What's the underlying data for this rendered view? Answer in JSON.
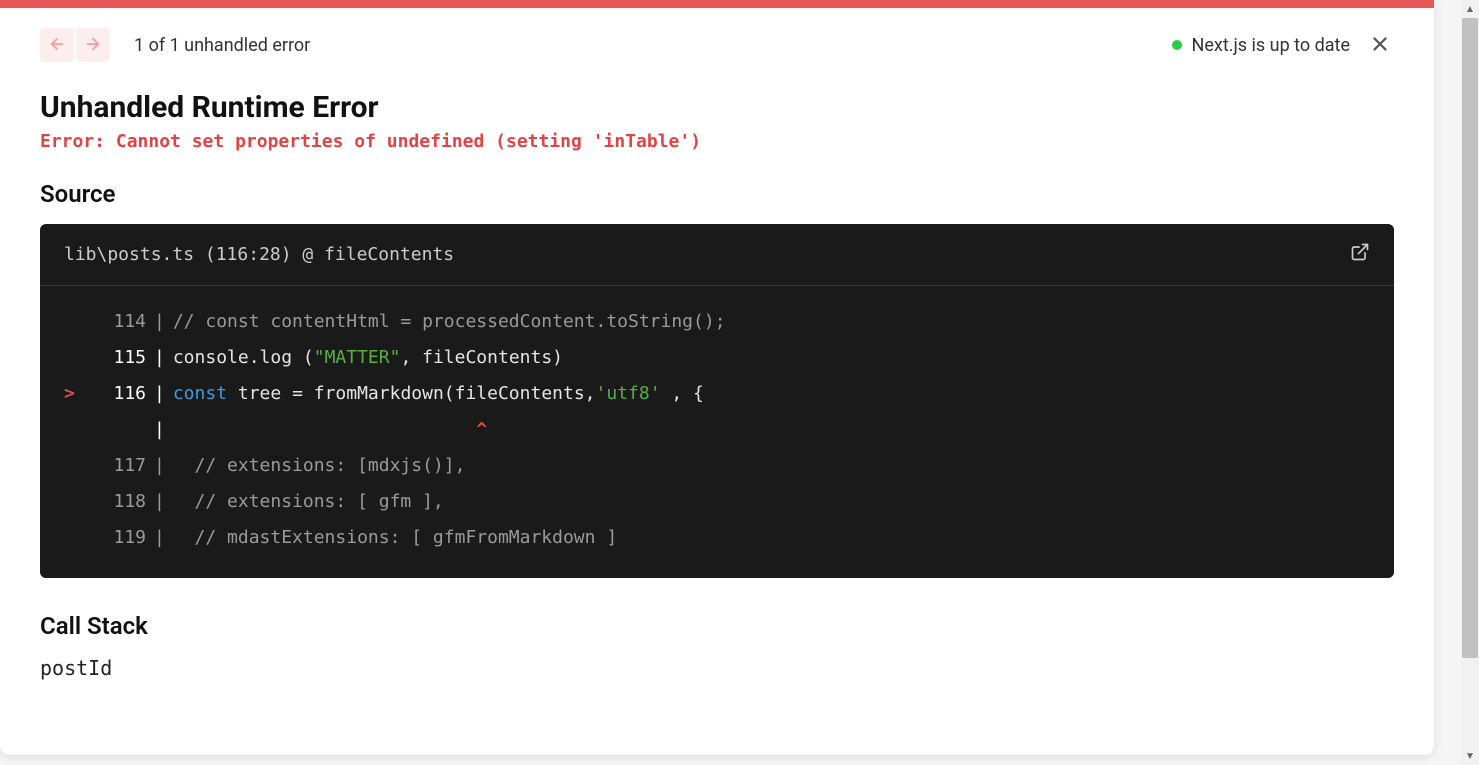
{
  "header": {
    "error_counter": "1 of 1 unhandled error",
    "status_text": "Next.js is up to date"
  },
  "error": {
    "title": "Unhandled Runtime Error",
    "message": "Error: Cannot set properties of undefined (setting 'inTable')"
  },
  "source": {
    "heading": "Source",
    "location": "lib\\posts.ts (116:28) @ fileContents"
  },
  "code": {
    "line114": {
      "num": "114",
      "text": "// const contentHtml = processedContent.toString();"
    },
    "line115": {
      "num": "115",
      "p1": "console",
      "p2": ".",
      "p3": "log",
      "p4": " (",
      "p5": "\"MATTER\"",
      "p6": ", fileContents)"
    },
    "line116": {
      "num": "116",
      "p1": "const",
      "p2": " tree ",
      "p3": "=",
      "p4": " fromMarkdown(fileContents,",
      "p5": "'utf8'",
      "p6": " , {"
    },
    "caret_line": "                            ^",
    "line117": {
      "num": "117",
      "text": "  // extensions: [mdxjs()],"
    },
    "line118": {
      "num": "118",
      "text": "  // extensions: [ gfm ],"
    },
    "line119": {
      "num": "119",
      "text": "  // mdastExtensions: [ gfmFromMarkdown ]"
    }
  },
  "callstack": {
    "heading": "Call Stack",
    "item0": "postId"
  },
  "icons": {
    "caret": ">",
    "pipe": "|"
  }
}
